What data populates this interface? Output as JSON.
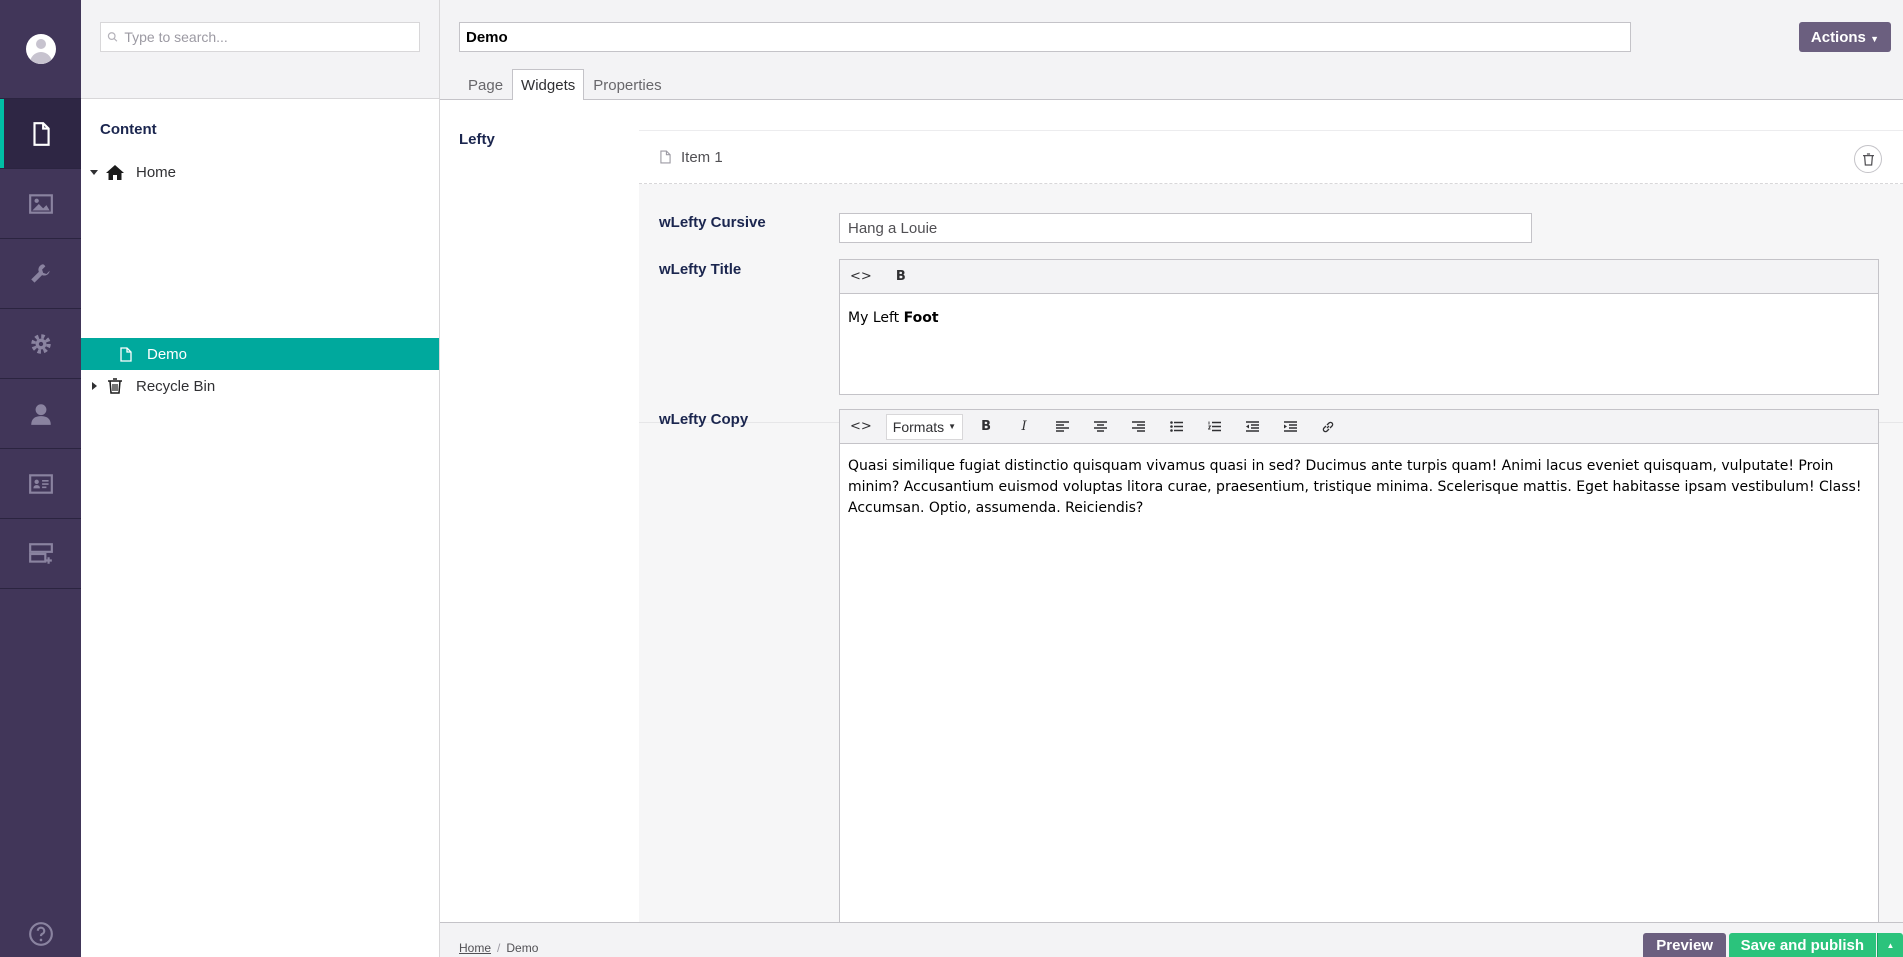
{
  "search": {
    "placeholder": "Type to search..."
  },
  "tree": {
    "title": "Content",
    "home": "Home",
    "demo": "Demo",
    "recycle": "Recycle Bin"
  },
  "header": {
    "name_value": "Demo",
    "actions_label": "Actions",
    "tabs": [
      "Page",
      "Widgets",
      "Properties"
    ],
    "active_tab": "Widgets"
  },
  "main": {
    "group_label": "Lefty",
    "item_label": "Item 1",
    "fields": {
      "cursive_label": "wLefty Cursive",
      "cursive_value": "Hang a Louie",
      "title_label": "wLefty Title",
      "title_text_plain": "My Left ",
      "title_text_bold": "Foot",
      "copy_label": "wLefty Copy",
      "copy_text": "Quasi similique fugiat distinctio quisquam vivamus quasi in sed? Ducimus ante turpis quam! Animi lacus eveniet quisquam, vulputate! Proin minim? Accusantium euismod voluptas litora curae, praesentium, tristique minima. Scelerisque mattis. Eget habitasse ipsam vestibulum! Class! Accumsan. Optio, assumenda. Reiciendis?"
    },
    "toolbar": {
      "code": "<>",
      "bold": "B",
      "italic": "I",
      "formats": "Formats"
    }
  },
  "footer": {
    "crumb_home": "Home",
    "crumb_sep": "/",
    "crumb_current": "Demo",
    "preview_label": "Preview",
    "publish_label": "Save and publish"
  },
  "colors": {
    "rail": "#413659",
    "accent": "#00bfa5",
    "selected_node": "#00a99d",
    "publish": "#2bc37c",
    "actions": "#6b5f7f"
  },
  "icons": {
    "rail": [
      "content-icon",
      "media-icon",
      "settings-wrench-icon",
      "developer-gear-icon",
      "users-icon",
      "members-icon",
      "forms-icon",
      "help-icon"
    ]
  }
}
